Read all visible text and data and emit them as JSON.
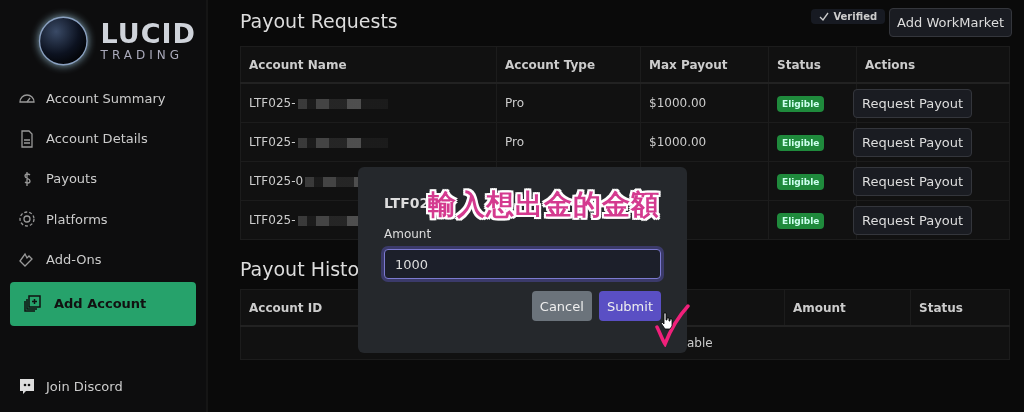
{
  "sidebar": {
    "logo": {
      "title": "LUCID",
      "subtitle": "TRADING"
    },
    "items": [
      {
        "label": "Account Summary"
      },
      {
        "label": "Account Details"
      },
      {
        "label": "Payouts"
      },
      {
        "label": "Platforms"
      },
      {
        "label": "Add-Ons"
      }
    ],
    "add_button": "Add Account",
    "discord": "Join Discord"
  },
  "header": {
    "title": "Payout Requests",
    "verified": "Verified",
    "button": "Add WorkMarket"
  },
  "requests": {
    "columns": [
      "Account Name",
      "Account Type",
      "Max Payout",
      "Status",
      "Actions"
    ],
    "rows": [
      {
        "name": "LTF025-",
        "type": "Pro",
        "max": "$1000.00",
        "status": "Eligible",
        "action": "Request Payout"
      },
      {
        "name": "LTF025-",
        "type": "Pro",
        "max": "$1000.00",
        "status": "Eligible",
        "action": "Request Payout"
      },
      {
        "name": "LTF025-0",
        "status": "Eligible",
        "action": "Request Payout"
      },
      {
        "name": "LTF025-",
        "status": "Eligible",
        "action": "Request Payout"
      }
    ]
  },
  "history": {
    "title": "Payout Histo",
    "columns": [
      "Account ID",
      "Amount",
      "Status"
    ],
    "empty": "able"
  },
  "dialog": {
    "title": "LTF02",
    "label": "Amount",
    "value": "1000",
    "cancel": "Cancel",
    "submit": "Submit"
  },
  "annotation": {
    "text": "輸入想出金的金額"
  }
}
